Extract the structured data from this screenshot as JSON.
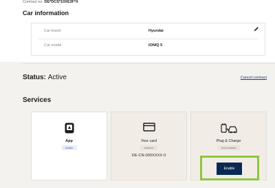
{
  "contract": {
    "label": "Contract no.",
    "number": "DE*DCS*10XE3F*X"
  },
  "car_information": {
    "title": "Car information",
    "rows": [
      {
        "label": "Car brand",
        "value": "Hyundai"
      },
      {
        "label": "Car model",
        "value": "IONIQ 5"
      }
    ],
    "edit_icon": "pencil-icon"
  },
  "status": {
    "label": "Status:",
    "value": "Active",
    "cancel_link": "Cancel contract"
  },
  "services": {
    "title": "Services",
    "cards": [
      {
        "icon": "app-icon",
        "name": "App",
        "badge": "Active"
      },
      {
        "icon": "card-icon",
        "name": "Your card",
        "badge": "Inactive",
        "id": "DE-CN-000XXXX-0"
      },
      {
        "icon": "plug-charge-icon",
        "name": "Plug & Charge",
        "badge": "Not enabled",
        "button": "Enable"
      }
    ]
  },
  "colors": {
    "accent": "#0a2a53",
    "highlight": "#8dc63f",
    "card_bg": "#f2ece6"
  }
}
